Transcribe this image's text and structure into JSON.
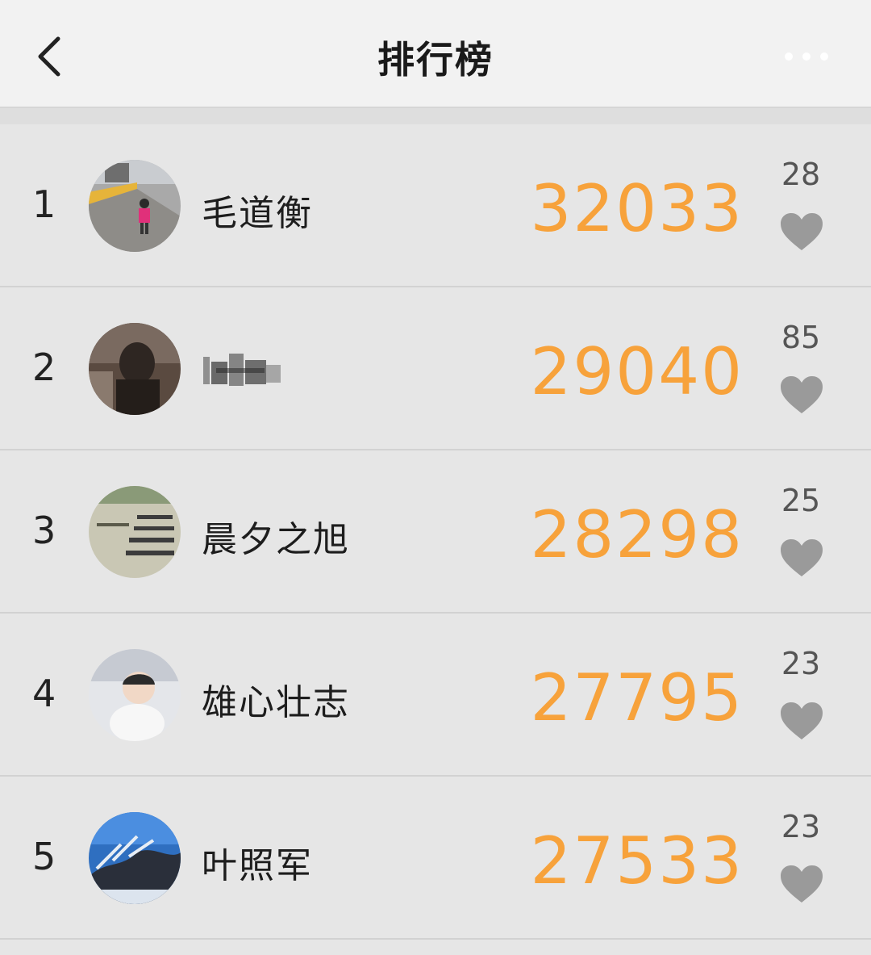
{
  "header": {
    "title": "排行榜"
  },
  "rows": [
    {
      "rank": "1",
      "name": "毛道衡",
      "score": "32033",
      "likes": "28"
    },
    {
      "rank": "2",
      "name": "",
      "score": "29040",
      "likes": "85"
    },
    {
      "rank": "3",
      "name": "晨夕之旭",
      "score": "28298",
      "likes": "25"
    },
    {
      "rank": "4",
      "name": "雄心壮志",
      "score": "27795",
      "likes": "23"
    },
    {
      "rank": "5",
      "name": "叶照军",
      "score": "27533",
      "likes": "23"
    }
  ],
  "icons": {
    "back": "chevron-left-icon",
    "more": "more-dots-icon",
    "like": "heart-icon"
  },
  "colors": {
    "score": "#f7a23b",
    "heart": "#9a9a9a",
    "background": "#e6e6e6",
    "navbar": "#f2f2f2"
  }
}
